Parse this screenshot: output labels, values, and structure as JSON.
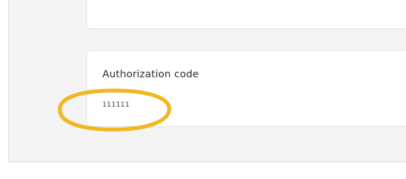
{
  "authorization": {
    "label": "Authorization code",
    "value": "111111"
  },
  "colors": {
    "panel_background": "#f4f4f4",
    "card_background": "#ffffff",
    "highlight_ring": "#f2b61e"
  },
  "annotation": {
    "shape": "ellipse",
    "target": "authorization-code-value"
  }
}
